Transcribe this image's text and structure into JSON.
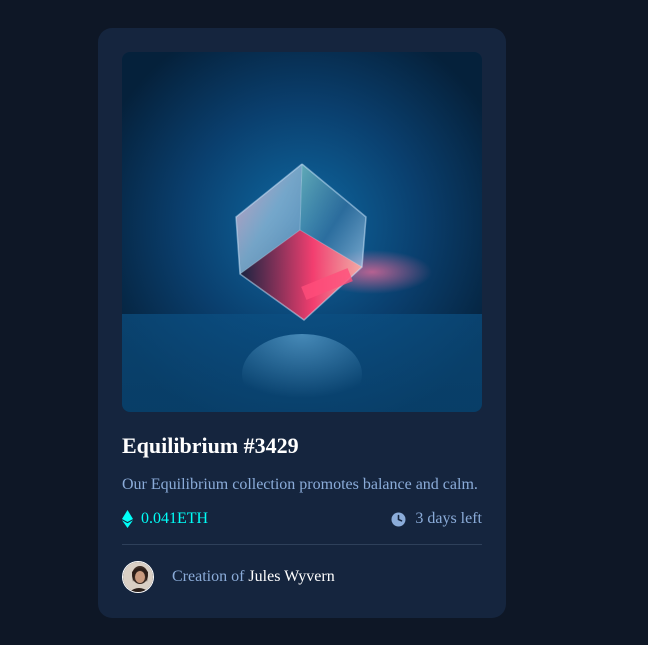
{
  "card": {
    "title": "Equilibrium #3429",
    "description": "Our Equilibrium collection promotes balance and calm.",
    "price": "0.041ETH",
    "time_left": "3 days left",
    "creator_prefix": "Creation of",
    "creator_name": "Jules Wyvern"
  },
  "icons": {
    "price": "ethereum-icon",
    "time": "clock-icon"
  },
  "colors": {
    "page_bg": "#0e1726",
    "card_bg": "#15253e",
    "accent": "#00fff8",
    "muted_text": "#8bacd9",
    "white": "#ffffff"
  }
}
